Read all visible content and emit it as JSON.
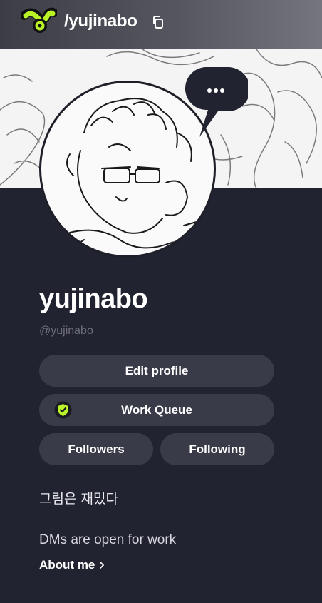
{
  "header": {
    "site_path": "/yujinabo",
    "logo_icon": "vgen-logo-icon",
    "copy_icon": "copy-icon",
    "accent_color": "#b9f227"
  },
  "profile": {
    "display_name": "yujinabo",
    "handle": "@yujinabo",
    "avatar_icon": "sketch-portrait-avatar",
    "more_icon": "ellipsis-icon"
  },
  "actions": {
    "edit_profile": "Edit profile",
    "work_queue": "Work Queue",
    "work_queue_icon": "verified-check-icon",
    "followers": "Followers",
    "following": "Following"
  },
  "bio": {
    "tagline": "그림은 재밌다",
    "dm_note": "DMs are open for work",
    "about_link": "About me",
    "about_icon": "chevron-right-icon"
  }
}
